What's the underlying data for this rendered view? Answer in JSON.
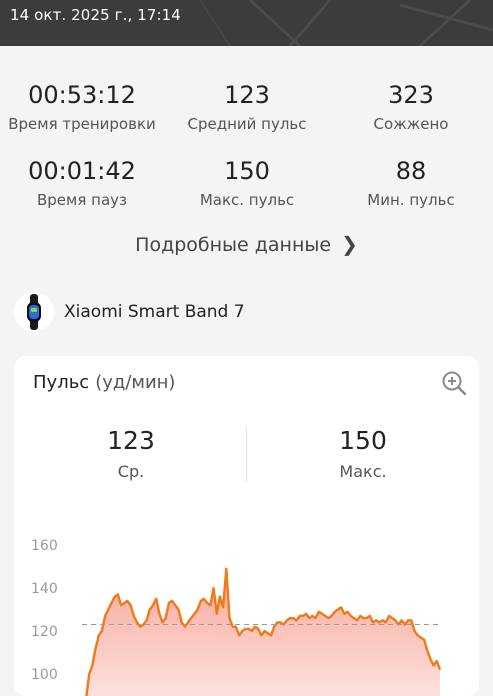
{
  "header": {
    "datetime": "14 окт. 2025 г., 17:14"
  },
  "stats": [
    {
      "value": "00:53:12",
      "label": "Время тренировки"
    },
    {
      "value": "123",
      "label": "Средний пульс"
    },
    {
      "value": "323",
      "label": "Сожжено"
    },
    {
      "value": "00:01:42",
      "label": "Время пауз"
    },
    {
      "value": "150",
      "label": "Макс. пульс"
    },
    {
      "value": "88",
      "label": "Мин. пульс"
    }
  ],
  "details_link": "Подробные данные",
  "device": {
    "name": "Xiaomi Smart Band 7",
    "icon": "band-icon"
  },
  "heart_card": {
    "title": "Пульс",
    "unit": "(уд/мин)",
    "avg_value": "123",
    "avg_label": "Ср.",
    "max_value": "150",
    "max_label": "Макс."
  },
  "chart_data": {
    "type": "area",
    "y_ticks": [
      "160",
      "140",
      "120",
      "100"
    ],
    "ylim": [
      100,
      160
    ],
    "average_line": 123,
    "series": [
      {
        "values": [
          88,
          100,
          104,
          112,
          118,
          120,
          127,
          130,
          133,
          136,
          137,
          132,
          133,
          134,
          132,
          127,
          124,
          122,
          123,
          125,
          130,
          132,
          135,
          128,
          124,
          126,
          133,
          134,
          132,
          130,
          124,
          122,
          124,
          126,
          128,
          130,
          134,
          135,
          133,
          132,
          140,
          128,
          136,
          131,
          149,
          126,
          122,
          122,
          118,
          120,
          121,
          121,
          120,
          122,
          121,
          118,
          120,
          119,
          118,
          122,
          124,
          124,
          123,
          125,
          126,
          126,
          125,
          127,
          127,
          128,
          126,
          127,
          126,
          129,
          128,
          127,
          126,
          127,
          129,
          130,
          131,
          128,
          129,
          127,
          126,
          125,
          127,
          126,
          126,
          127,
          124,
          125,
          124,
          125,
          124,
          127,
          126,
          125,
          123,
          125,
          123,
          125,
          125,
          120,
          118,
          117,
          116,
          111,
          107,
          104,
          106,
          102
        ]
      }
    ],
    "colors": {
      "line": "#f07a1b",
      "fill_top": "#f6a79a",
      "fill_bottom": "#fde6e2",
      "grid": "#cccccc",
      "axis_text": "#9a9a9a"
    }
  }
}
